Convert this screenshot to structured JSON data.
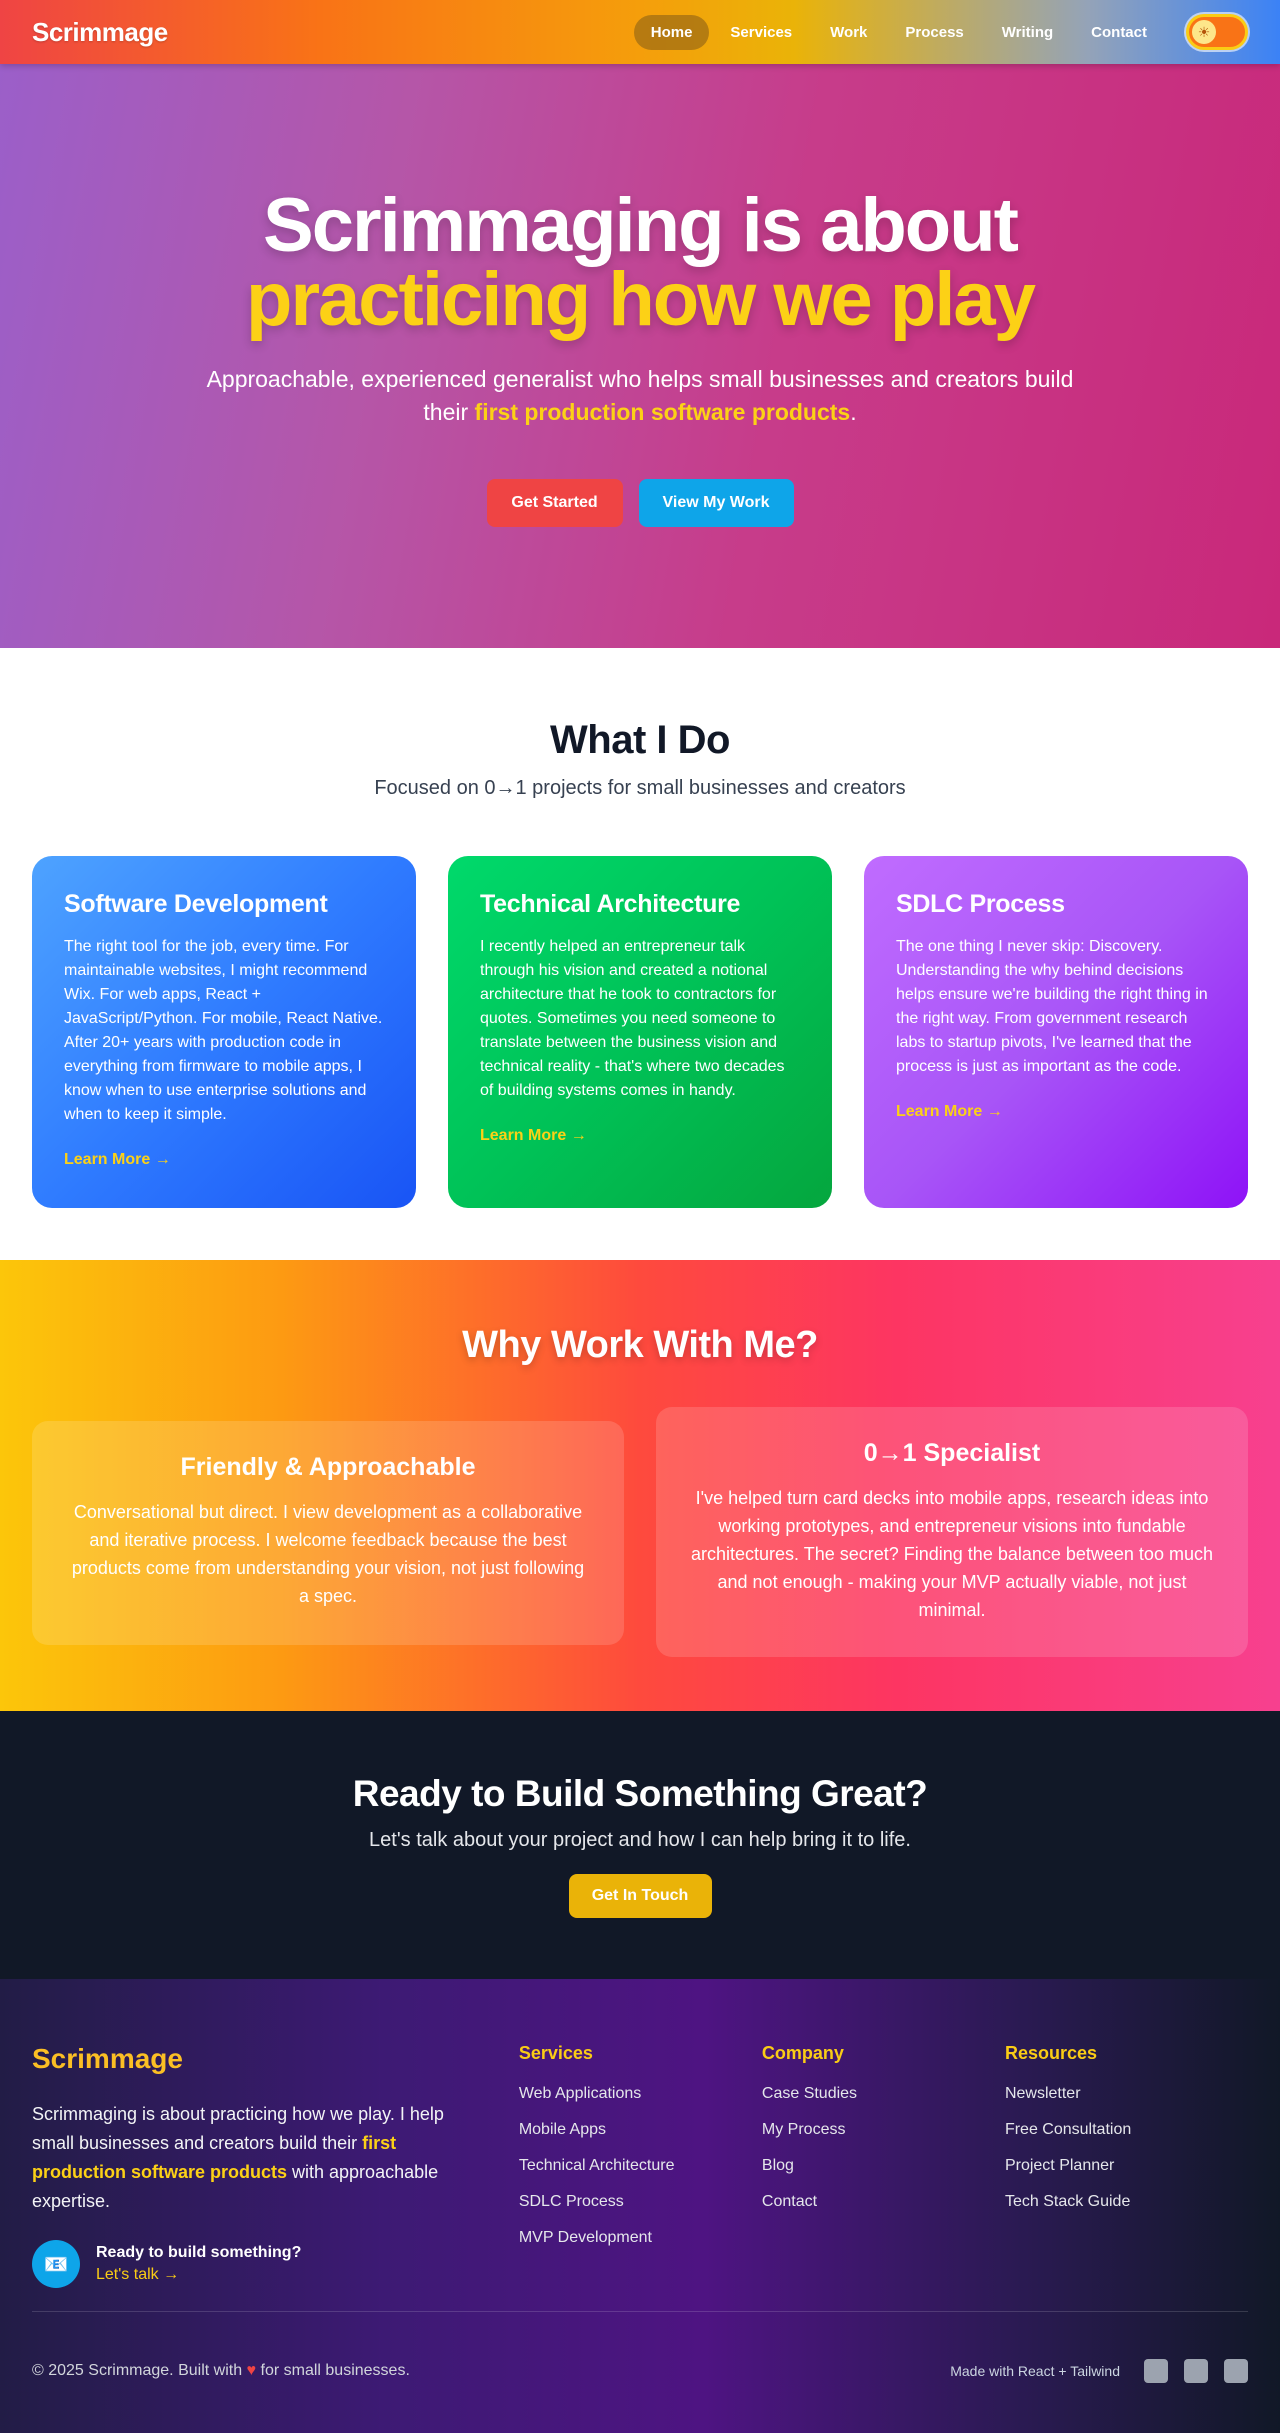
{
  "nav": {
    "brand": "Scrimmage",
    "links": [
      "Home",
      "Services",
      "Work",
      "Process",
      "Writing",
      "Contact"
    ],
    "active": "Home",
    "toggle_icon": "sun-icon"
  },
  "hero": {
    "title_line1": "Scrimmaging is about",
    "title_line2": "practicing how we play",
    "sub_before": "Approachable, experienced generalist who helps small businesses and creators build their ",
    "sub_highlight": "first production software products",
    "sub_after": ".",
    "btn_primary": "Get Started",
    "btn_secondary": "View My Work"
  },
  "what": {
    "title": "What I Do",
    "subtitle": "Focused on 0→1 projects for small businesses and creators",
    "cards": [
      {
        "title": "Software Development",
        "body": "The right tool for the job, every time. For maintainable websites, I might recommend Wix. For web apps, React + JavaScript/Python. For mobile, React Native. After 20+ years with production code in everything from firmware to mobile apps, I know when to use enterprise solutions and when to keep it simple.",
        "link": "Learn More →"
      },
      {
        "title": "Technical Architecture",
        "body": "I recently helped an entrepreneur talk through his vision and created a notional architecture that he took to contractors for quotes. Sometimes you need someone to translate between the business vision and technical reality - that's where two decades of building systems comes in handy.",
        "link": "Learn More →"
      },
      {
        "title": "SDLC Process",
        "body": "The one thing I never skip: Discovery. Understanding the why behind decisions helps ensure we're building the right thing in the right way. From government research labs to startup pivots, I've learned that the process is just as important as the code.",
        "link": "Learn More →"
      }
    ]
  },
  "why": {
    "title": "Why Work With Me?",
    "cards": [
      {
        "title": "Friendly & Approachable",
        "body": "Conversational but direct. I view development as a collaborative and iterative process. I welcome feedback because the best products come from understanding your vision, not just following a spec."
      },
      {
        "title": "0→1 Specialist",
        "body": "I've helped turn card decks into mobile apps, research ideas into working prototypes, and entrepreneur visions into fundable architectures. The secret? Finding the balance between too much and not enough - making your MVP actually viable, not just minimal."
      }
    ]
  },
  "cta": {
    "title": "Ready to Build Something Great?",
    "subtitle": "Let's talk about your project and how I can help bring it to life.",
    "button": "Get In Touch"
  },
  "footer": {
    "brand": "Scrimmage",
    "desc_before": "Scrimmaging is about practicing how we play. I help small businesses and creators build their ",
    "desc_highlight": "first production software products",
    "desc_after": " with approachable expertise.",
    "cta_icon": "email-icon",
    "cta_title": "Ready to build something?",
    "cta_link": "Let's talk →",
    "columns": [
      {
        "title": "Services",
        "items": [
          "Web Applications",
          "Mobile Apps",
          "Technical Architecture",
          "SDLC Process",
          "MVP Development"
        ]
      },
      {
        "title": "Company",
        "items": [
          "Case Studies",
          "My Process",
          "Blog",
          "Contact"
        ]
      },
      {
        "title": "Resources",
        "items": [
          "Newsletter",
          "Free Consultation",
          "Project Planner",
          "Tech Stack Guide"
        ]
      }
    ],
    "copy_before": "© 2025 Scrimmage. Built with ",
    "copy_after": " for small businesses.",
    "heart_icon": "heart-icon",
    "made_with": "Made with React + Tailwind",
    "social_icons": [
      "social-icon-1",
      "social-icon-2",
      "social-icon-3"
    ]
  }
}
